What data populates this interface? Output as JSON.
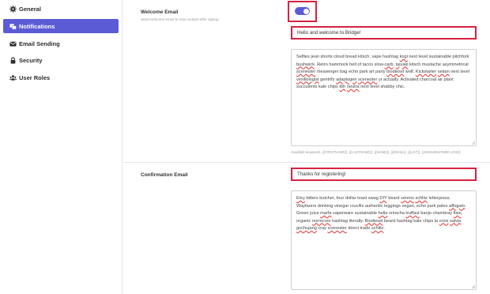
{
  "sidebar": {
    "items": [
      {
        "label": "General",
        "icon": "gear-icon"
      },
      {
        "label": "Notifications",
        "icon": "notifications-icon"
      },
      {
        "label": "Email Sending",
        "icon": "envelope-icon"
      },
      {
        "label": "Security",
        "icon": "lock-icon"
      },
      {
        "label": "User Roles",
        "icon": "users-icon"
      }
    ],
    "active_index": 1
  },
  "welcome": {
    "title": "Welcome Email",
    "description": "Send welcome email to new contact after signup.",
    "enabled": true,
    "subject": "Hello and welcome to Bridge!",
    "body_parts": [
      {
        "t": "Selfies jean shorts cloud bread kitsch, vape hashtag "
      },
      {
        "t": "kogi",
        "sp": true
      },
      {
        "t": " next level sustainable pitchfork "
      },
      {
        "t": "bushwick",
        "sp": true
      },
      {
        "t": ". Retro hammock hell of tacos slow-"
      },
      {
        "t": "carb",
        "sp": true
      },
      {
        "t": ", "
      },
      {
        "t": "taiyaki",
        "sp": true
      },
      {
        "t": " kitsch mustache asymmetrical "
      },
      {
        "t": "scenester",
        "sp": true
      },
      {
        "t": " messenger bag echo park art party "
      },
      {
        "t": "biodiesel",
        "sp": true
      },
      {
        "t": " wolf. "
      },
      {
        "t": "Kickstarter",
        "sp": true
      },
      {
        "t": " "
      },
      {
        "t": "seitan",
        "sp": true
      },
      {
        "t": " next level "
      },
      {
        "t": "vexillologist",
        "sp": true
      },
      {
        "t": " gentrify "
      },
      {
        "t": "adaptogen",
        "sp": true
      },
      {
        "t": " "
      },
      {
        "t": "scenester",
        "sp": true
      },
      {
        "t": " yr actually. Activated charcoal air plant succulents kale chips "
      },
      {
        "t": "tbh",
        "sp": true
      },
      {
        "t": " "
      },
      {
        "t": "neutra",
        "sp": true
      },
      {
        "t": " next level shabby chic."
      }
    ],
    "keywords": "Available keywords. {{FIRSTNAME}}, {{LASTNAME}}, {{NAME}}, {{EMAIL}}, {{LIST}}, {{UNSUBSCRIBE-LINK}}"
  },
  "confirmation": {
    "title": "Confirmation Email",
    "subject": "Thanks for registering!",
    "body_parts": [
      {
        "t": "Etsy",
        "sp": true
      },
      {
        "t": " bitters butcher, four dollar toast swag "
      },
      {
        "t": "DIY",
        "sp": true
      },
      {
        "t": " beard "
      },
      {
        "t": "venmo",
        "sp": true
      },
      {
        "t": " "
      },
      {
        "t": "schlitz",
        "sp": true
      },
      {
        "t": " letterpress. Wayfarers drinking vinegar crucifix authentic leggings vegan, echo park paleo "
      },
      {
        "t": "affogato",
        "sp": true
      },
      {
        "t": ". Green juice "
      },
      {
        "t": "marfa",
        "sp": true
      },
      {
        "t": " vaporware sustainable "
      },
      {
        "t": "hella",
        "sp": true
      },
      {
        "t": " sriracha "
      },
      {
        "t": "truffaut",
        "sp": true
      },
      {
        "t": " banjo chambray "
      },
      {
        "t": "fixie",
        "sp": true
      },
      {
        "t": ", organic "
      },
      {
        "t": "normcore",
        "sp": true
      },
      {
        "t": " hashtag literally. "
      },
      {
        "t": "Biodiesel",
        "sp": true
      },
      {
        "t": " beard hashtag kale chips la "
      },
      {
        "t": "croix",
        "sp": true
      },
      {
        "t": " "
      },
      {
        "t": "salvia",
        "sp": true
      },
      {
        "t": " "
      },
      {
        "t": "gochujang",
        "sp": true
      },
      {
        "t": " cray "
      },
      {
        "t": "scenester",
        "sp": true
      },
      {
        "t": " direct trade "
      },
      {
        "t": "schlitz",
        "sp": true
      },
      {
        "t": "."
      }
    ]
  },
  "colors": {
    "accent": "#5b5bd6",
    "highlight": "#d6223f",
    "spellcheck": "#dd3333"
  }
}
